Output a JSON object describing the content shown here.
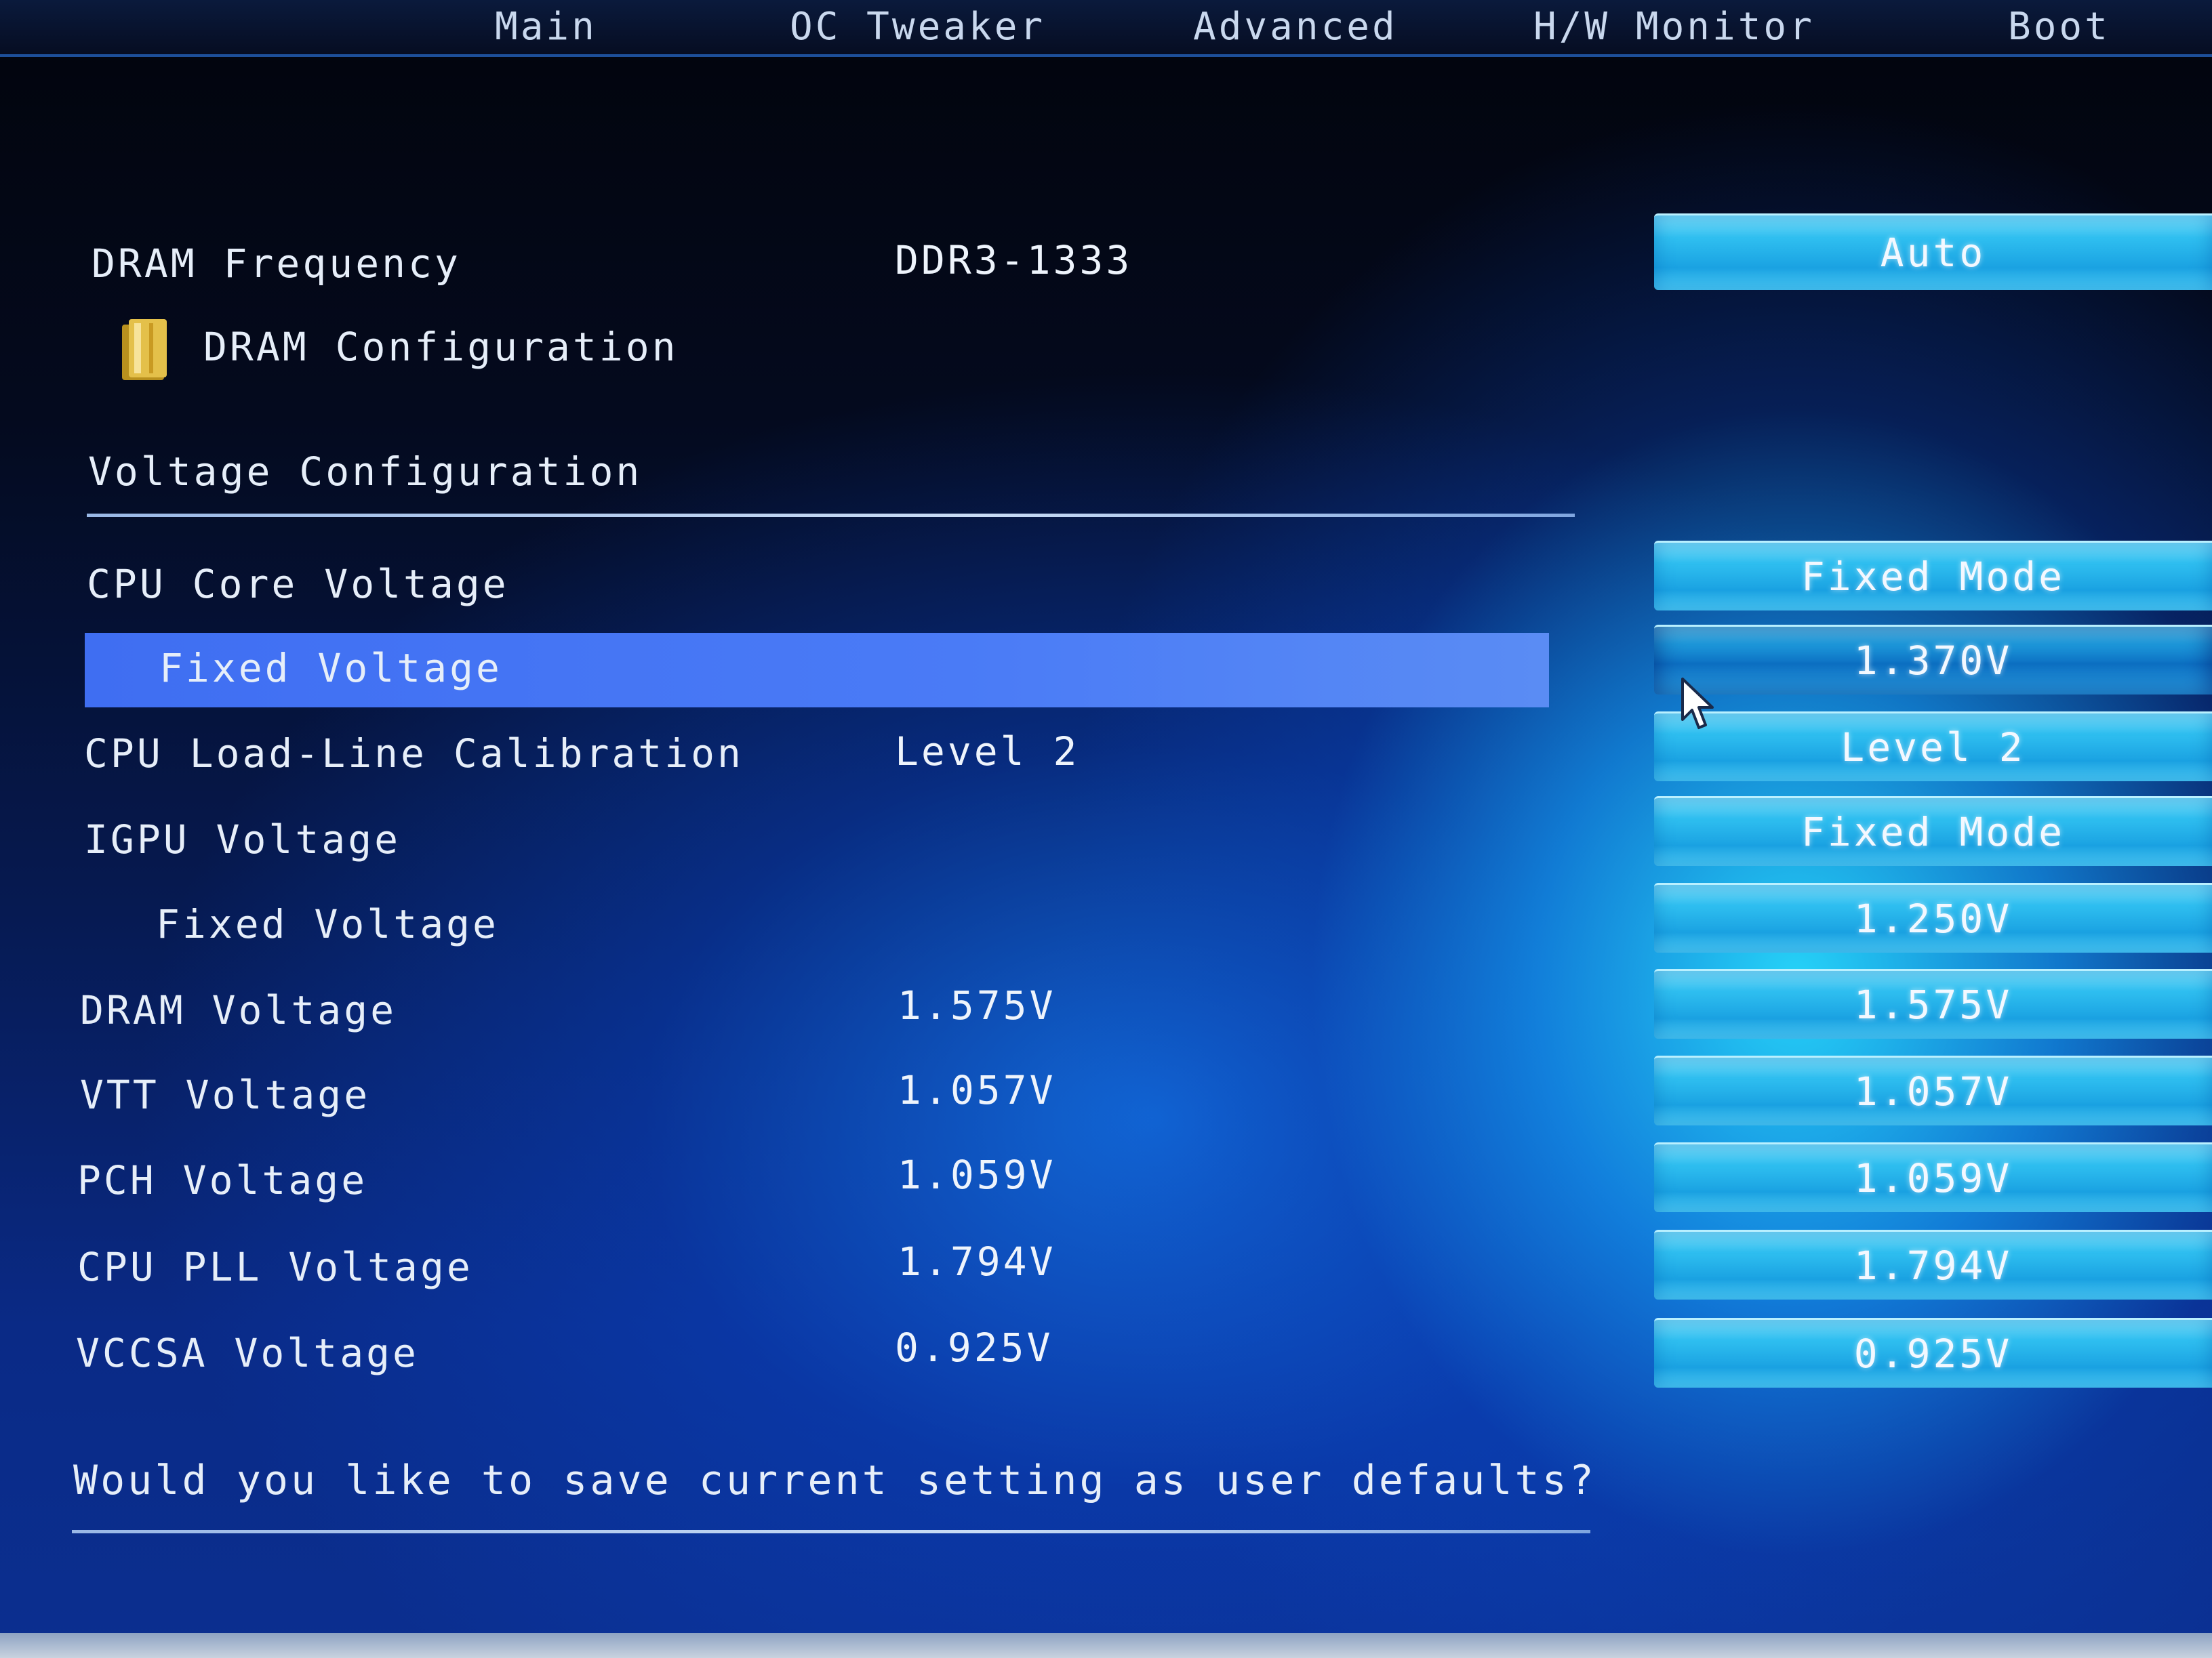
{
  "tabs": [
    "Main",
    "OC Tweaker",
    "Advanced",
    "H/W Monitor",
    "Boot"
  ],
  "dram_frequency": {
    "label": "DRAM Frequency",
    "value": "DDR3-1333",
    "option": "Auto"
  },
  "dram_configuration": {
    "label": "DRAM Configuration",
    "icon": "folder-icon"
  },
  "voltage_section_title": "Voltage Configuration",
  "cpu_core_voltage": {
    "label": "CPU Core Voltage",
    "option": "Fixed Mode"
  },
  "cpu_fixed_voltage": {
    "label": "Fixed Voltage",
    "option": "1.370V"
  },
  "cpu_llc": {
    "label": "CPU Load-Line Calibration",
    "value": "Level 2",
    "option": "Level 2"
  },
  "igpu_voltage": {
    "label": "IGPU Voltage",
    "option": "Fixed Mode"
  },
  "igpu_fixed_voltage": {
    "label": "Fixed Voltage",
    "option": "1.250V"
  },
  "dram_voltage": {
    "label": "DRAM Voltage",
    "value": "1.575V",
    "option": "1.575V"
  },
  "vtt_voltage": {
    "label": "VTT Voltage",
    "value": "1.057V",
    "option": "1.057V"
  },
  "pch_voltage": {
    "label": "PCH Voltage",
    "value": "1.059V",
    "option": "1.059V"
  },
  "cpu_pll_voltage": {
    "label": "CPU PLL Voltage",
    "value": "1.794V",
    "option": "1.794V"
  },
  "vccsa_voltage": {
    "label": "VCCSA Voltage",
    "value": "0.925V",
    "option": "0.925V"
  },
  "save_prompt": "Would you like to save current setting as user defaults?",
  "colors": {
    "highlight": "#4a7bf6",
    "button": "#2fbff0",
    "text": "#e6eef9"
  }
}
